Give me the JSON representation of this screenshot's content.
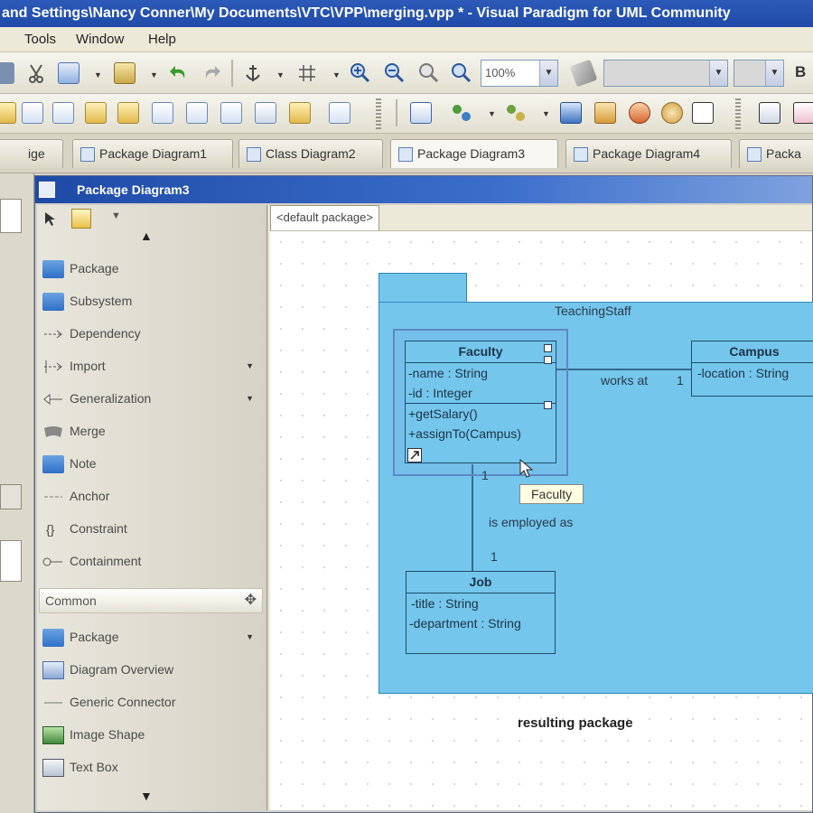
{
  "window": {
    "title": " and Settings\\Nancy Conner\\My Documents\\VTC\\VPP\\merging.vpp * - Visual Paradigm for UML Community"
  },
  "menu": [
    "Tools",
    "Window",
    "Help"
  ],
  "toolbar": {
    "zoom_value": "100%"
  },
  "diagram_tabs": [
    {
      "label": "ige"
    },
    {
      "label": "Package Diagram1"
    },
    {
      "label": "Class Diagram2"
    },
    {
      "label": "Package Diagram3"
    },
    {
      "label": "Package Diagram4"
    },
    {
      "label": "Packa"
    }
  ],
  "inner_window": {
    "title": "Package Diagram3"
  },
  "palette": {
    "items": [
      {
        "label": "Package",
        "icon": "package-icon"
      },
      {
        "label": "Subsystem",
        "icon": "subsystem-icon"
      },
      {
        "label": "Dependency",
        "icon": "dependency-icon"
      },
      {
        "label": "Import",
        "icon": "import-icon"
      },
      {
        "label": "Generalization",
        "icon": "generalization-icon"
      },
      {
        "label": "Merge",
        "icon": "merge-icon"
      },
      {
        "label": "Note",
        "icon": "note-icon"
      },
      {
        "label": "Anchor",
        "icon": "anchor-icon"
      },
      {
        "label": "Constraint",
        "icon": "constraint-icon"
      },
      {
        "label": "Containment",
        "icon": "containment-icon"
      }
    ],
    "common_group": "Common",
    "common_items": [
      {
        "label": "Package",
        "icon": "package-icon"
      },
      {
        "label": "Diagram Overview",
        "icon": "diagram-overview-icon"
      },
      {
        "label": "Generic Connector",
        "icon": "generic-connector-icon"
      },
      {
        "label": "Image Shape",
        "icon": "image-shape-icon"
      },
      {
        "label": "Text Box",
        "icon": "text-box-icon"
      }
    ]
  },
  "canvas": {
    "package_tab": "<default package>",
    "package_name": "TeachingStaff",
    "faculty": {
      "name": "Faculty",
      "attributes": [
        "-name : String",
        "-id : Integer"
      ],
      "operations": [
        "+getSalary()",
        "+assignTo(Campus)"
      ]
    },
    "campus": {
      "name": "Campus",
      "attributes": [
        "-location : String"
      ]
    },
    "job": {
      "name": "Job",
      "attributes": [
        "-title : String",
        "-department : String"
      ]
    },
    "assoc_works_at": "works at",
    "mult_campus": "1",
    "assoc_employed": "is employed as",
    "mult_faculty": "1",
    "mult_job": "1",
    "tooltip": "Faculty",
    "caption": "resulting package"
  },
  "colors": {
    "package_fill": "#74c6ec",
    "title_bar": "#1f4aa8"
  }
}
